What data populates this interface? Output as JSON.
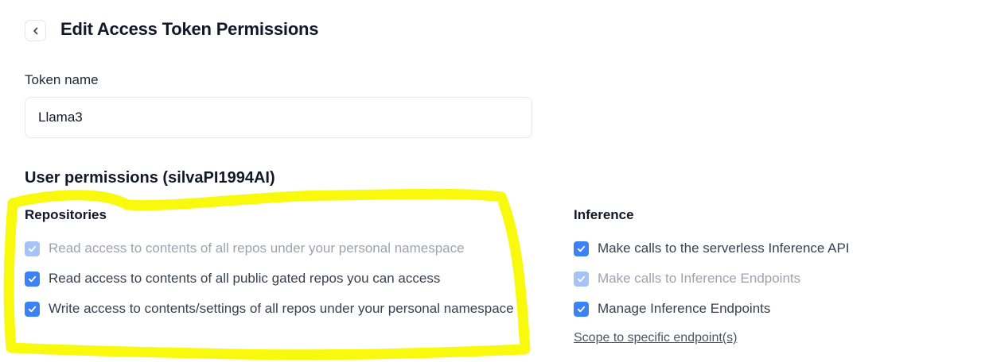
{
  "header": {
    "title": "Edit Access Token Permissions"
  },
  "token": {
    "label": "Token name",
    "value": "Llama3"
  },
  "user_permissions": {
    "title": "User permissions (silvaPI1994AI)",
    "repositories": {
      "heading": "Repositories",
      "items": [
        {
          "label": "Read access to contents of all repos under your personal namespace",
          "checked": true,
          "disabled": true
        },
        {
          "label": "Read access to contents of all public gated repos you can access",
          "checked": true,
          "disabled": false
        },
        {
          "label": "Write access to contents/settings of all repos under your personal namespace",
          "checked": true,
          "disabled": false
        }
      ]
    },
    "inference": {
      "heading": "Inference",
      "items": [
        {
          "label": "Make calls to the serverless Inference API",
          "checked": true,
          "disabled": false
        },
        {
          "label": "Make calls to Inference Endpoints",
          "checked": true,
          "disabled": true
        },
        {
          "label": "Manage Inference Endpoints",
          "checked": true,
          "disabled": false
        }
      ],
      "scope_link": "Scope to specific endpoint(s)"
    }
  },
  "colors": {
    "checkbox_active": "#3b82f6",
    "checkbox_disabled": "#a5c3f5",
    "annotation_highlight": "#f9f900"
  }
}
